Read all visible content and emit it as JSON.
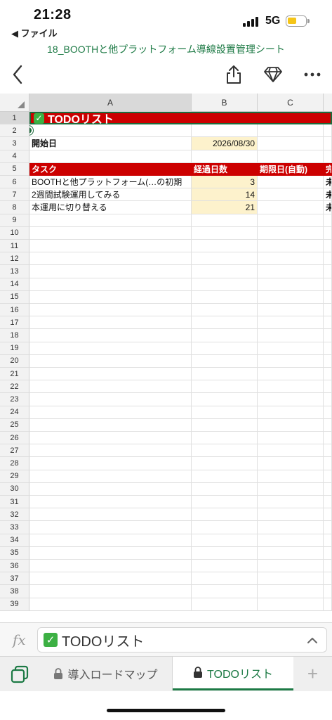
{
  "status_bar": {
    "time": "21:28",
    "back_app": "◀ ファイル",
    "network": "5G"
  },
  "document": {
    "title": "18_BOOTHと他プラットフォーム導線設置管理シート"
  },
  "grid": {
    "columns": [
      "A",
      "B",
      "C"
    ],
    "row_numbers": [
      "1",
      "2",
      "3",
      "4",
      "5",
      "6",
      "7",
      "8",
      "9",
      "10",
      "11",
      "12",
      "13",
      "14",
      "15",
      "16",
      "17",
      "18",
      "19",
      "20",
      "21",
      "22",
      "23",
      "24",
      "25",
      "26",
      "27",
      "28",
      "29",
      "30",
      "31",
      "32",
      "33",
      "34",
      "35",
      "36",
      "37",
      "38",
      "39"
    ],
    "title_row": {
      "text": "TODOリスト"
    },
    "start_date": {
      "label": "開始日",
      "value": "2026/08/30"
    },
    "table_headers": {
      "task": "タスク",
      "elapsed_days": "経過日数",
      "due_date": "期限日(自動)",
      "status_partial": "完"
    },
    "tasks": [
      {
        "task": "BOOTHと他プラットフォーム(…の初期",
        "elapsed": "3",
        "status": "未"
      },
      {
        "task": "2週間試験運用してみる",
        "elapsed": "14",
        "status": "未"
      },
      {
        "task": "本運用に切り替える",
        "elapsed": "21",
        "status": "未"
      }
    ]
  },
  "formula_bar": {
    "content": "TODOリスト"
  },
  "sheet_tabs": [
    {
      "label": "導入ロードマップ",
      "active": false
    },
    {
      "label": "TODOリスト",
      "active": true
    }
  ],
  "colors": {
    "header_red": "#cc0000",
    "accent_green": "#1d7a45",
    "highlight_yellow": "#fdf2cc"
  }
}
